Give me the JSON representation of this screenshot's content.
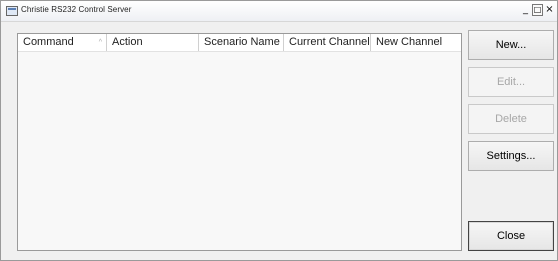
{
  "window": {
    "title": "Christie RS232 Control Server",
    "controls": {
      "minimize": "_",
      "maximize": "□",
      "close": "×"
    }
  },
  "list": {
    "columns": [
      "Command",
      "Action",
      "Scenario Name",
      "Current Channel",
      "New Channel"
    ],
    "sort_indicator": "^",
    "rows": []
  },
  "buttons": {
    "new": "New...",
    "edit": "Edit...",
    "delete": "Delete",
    "settings": "Settings...",
    "close": "Close"
  }
}
